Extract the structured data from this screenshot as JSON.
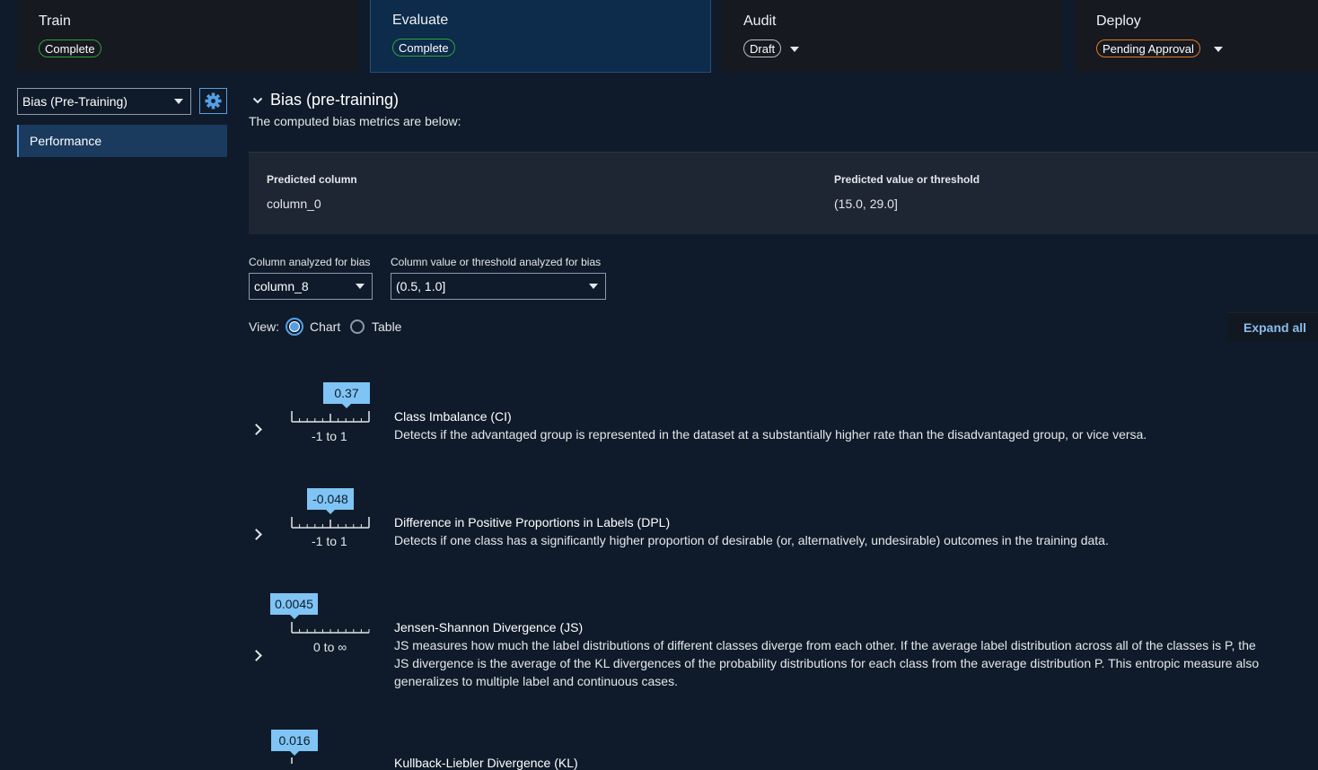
{
  "stages": [
    {
      "title": "Train",
      "status": "Complete"
    },
    {
      "title": "Evaluate",
      "status": "Complete"
    },
    {
      "title": "Audit",
      "status": "Draft"
    },
    {
      "title": "Deploy",
      "status": "Pending Approval"
    }
  ],
  "sidebar": {
    "report_select": "Bias (Pre-Training)",
    "nav_item": "Performance"
  },
  "section": {
    "title": "Bias (pre-training)",
    "subtitle": "The computed bias metrics are below:"
  },
  "info": {
    "predicted_column_label": "Predicted column",
    "predicted_column_value": "column_0",
    "predicted_value_label": "Predicted value or threshold",
    "predicted_value_value": "(15.0, 29.0]"
  },
  "filters": {
    "column_label": "Column analyzed for bias",
    "column_value": "column_8",
    "threshold_label": "Column value or threshold analyzed for bias",
    "threshold_value": "(0.5, 1.0]"
  },
  "view": {
    "label": "View:",
    "chart": "Chart",
    "table": "Table",
    "selected": "Chart",
    "expand_all": "Expand all"
  },
  "metrics": [
    {
      "value": "0.37",
      "range": "-1 to 1",
      "title": "Class Imbalance (CI)",
      "description": "Detects if the advantaged group is represented in the dataset at a substantially higher rate than the disadvantaged group, or vice versa."
    },
    {
      "value": "-0.048",
      "range": "-1 to 1",
      "title": "Difference in Positive Proportions in Labels (DPL)",
      "description": "Detects if one class has a significantly higher proportion of desirable (or, alternatively, undesirable) outcomes in the training data."
    },
    {
      "value": "0.0045",
      "range": "0 to ∞",
      "title": "Jensen-Shannon Divergence (JS)",
      "description": "JS measures how much the label distributions of different classes diverge from each other. If the average label distribution across all of the classes is P, the JS divergence is the average of the KL divergences of the probability distributions for each class from the average distribution P. This entropic measure also generalizes to multiple label and continuous cases."
    },
    {
      "value": "0.016",
      "range": "",
      "title": "Kullback-Liebler Divergence (KL)",
      "description": ""
    }
  ],
  "colors": {
    "background": "#0f1b2a",
    "accent": "#539fe5",
    "tag": "#7fc4f4",
    "complete": "#2aa33a",
    "pending": "#e07b21"
  }
}
